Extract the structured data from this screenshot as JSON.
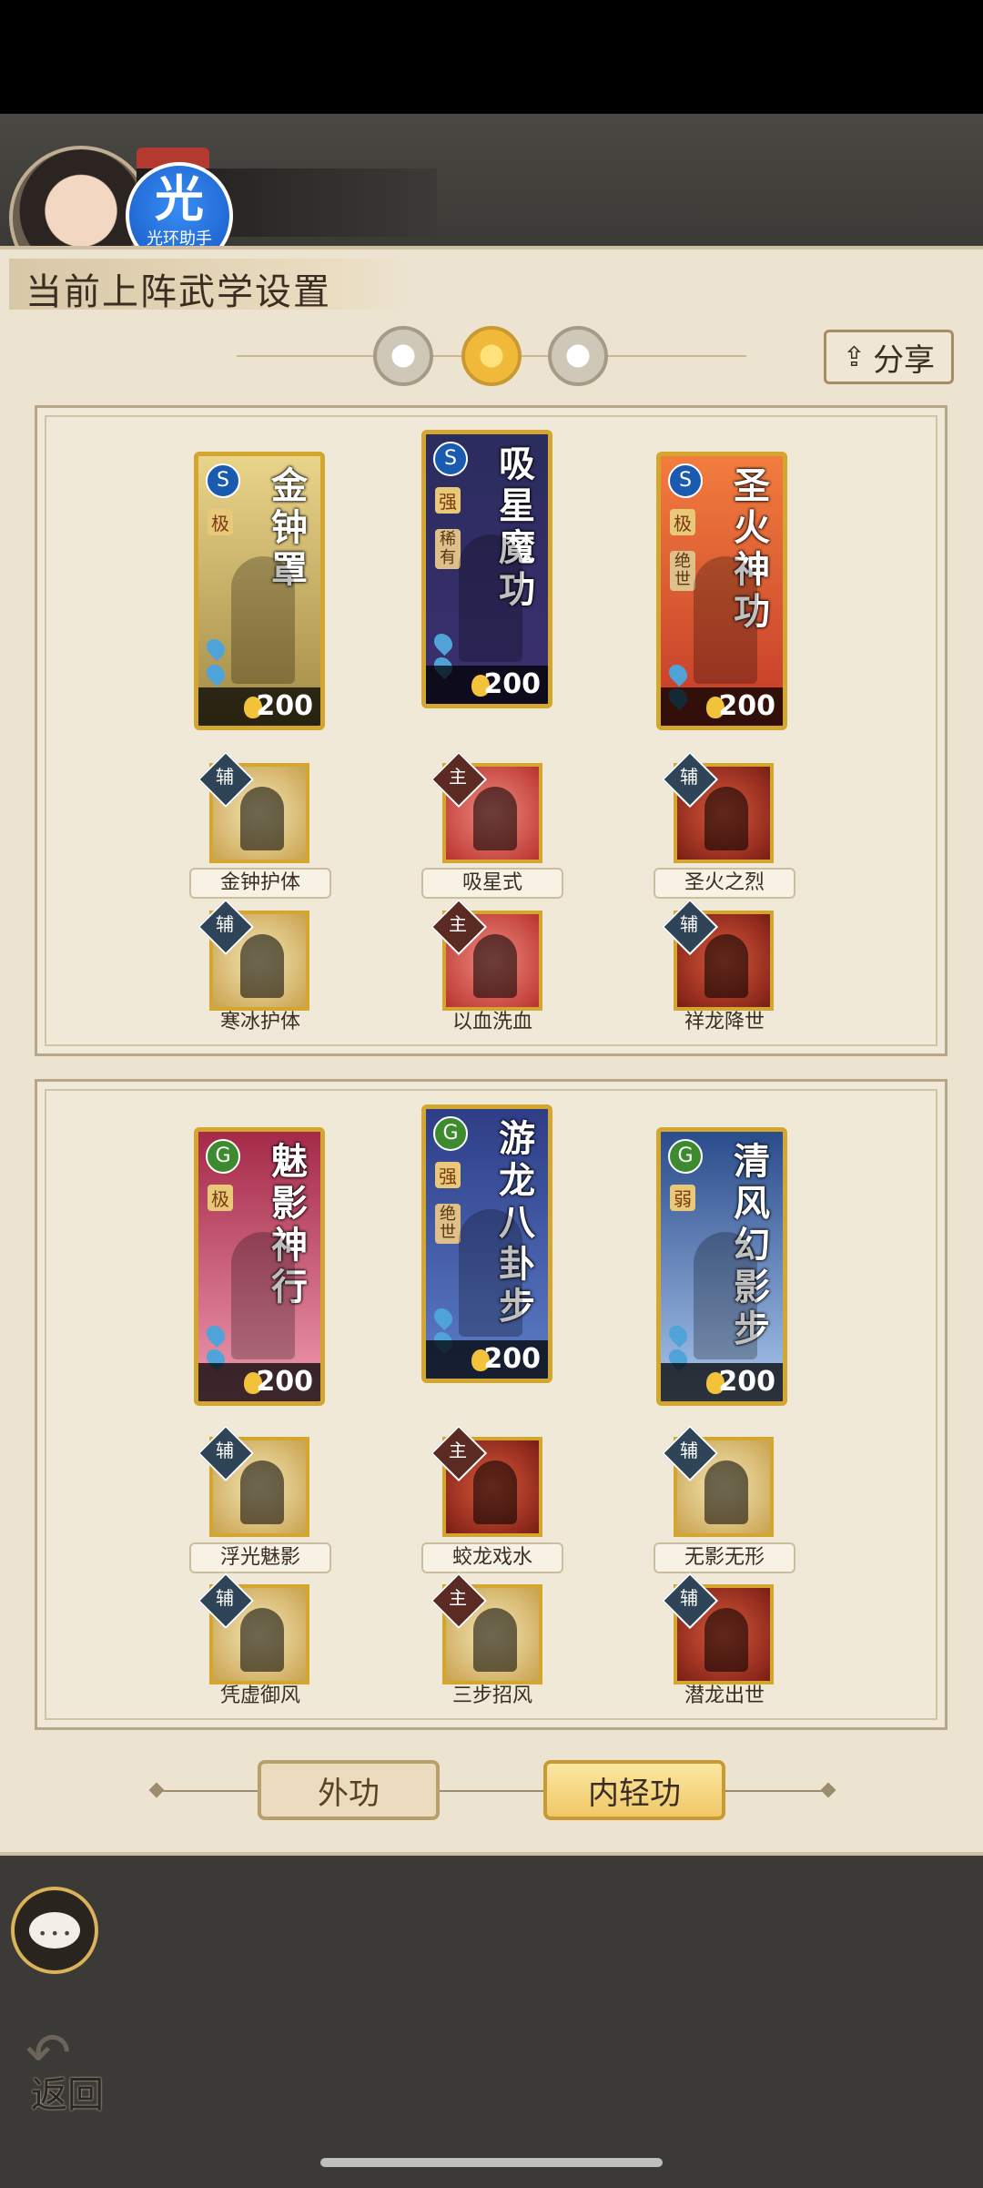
{
  "header": {
    "helper_char": "光",
    "helper_label": "光环助手",
    "title": "当前上阵武学设置",
    "share_label": "分享"
  },
  "groups": [
    {
      "cards": [
        {
          "title": "金钟罩",
          "element": "S",
          "grade": "极",
          "cost": "200"
        },
        {
          "title": "吸星魔功",
          "element": "S",
          "grade": "强",
          "rank": "稀有",
          "cost": "200"
        },
        {
          "title": "圣火神功",
          "element": "S",
          "grade": "极",
          "rank": "绝世",
          "cost": "200"
        }
      ],
      "skills_row1": [
        {
          "role": "辅",
          "name": "金钟护体"
        },
        {
          "role": "主",
          "name": "吸星式"
        },
        {
          "role": "辅",
          "name": "圣火之烈"
        }
      ],
      "skills_row2": [
        {
          "role": "辅",
          "name": "寒冰护体"
        },
        {
          "role": "主",
          "name": "以血洗血"
        },
        {
          "role": "辅",
          "name": "祥龙降世"
        }
      ]
    },
    {
      "cards": [
        {
          "title": "魅影神行",
          "element": "G",
          "grade": "极",
          "cost": "200"
        },
        {
          "title": "游龙八卦步",
          "element": "G",
          "grade": "强",
          "rank": "绝世",
          "cost": "200"
        },
        {
          "title": "清风幻影步",
          "element": "G",
          "grade": "弱",
          "cost": "200"
        }
      ],
      "skills_row1": [
        {
          "role": "辅",
          "name": "浮光魅影"
        },
        {
          "role": "主",
          "name": "蛟龙戏水"
        },
        {
          "role": "辅",
          "name": "无影无形"
        }
      ],
      "skills_row2": [
        {
          "role": "辅",
          "name": "凭虚御风"
        },
        {
          "role": "主",
          "name": "三步招风"
        },
        {
          "role": "辅",
          "name": "潜龙出世"
        }
      ]
    }
  ],
  "bottom_tabs": [
    "外功",
    "内轻功"
  ],
  "back_label": "返回",
  "colors": {
    "gold": "#d3a62f",
    "panel": "#ece3d1",
    "accent_blue": "#1558c5"
  }
}
